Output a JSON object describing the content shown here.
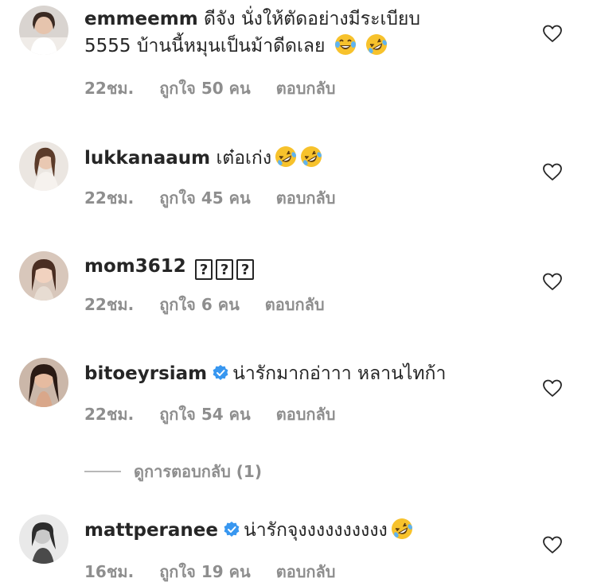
{
  "comments": [
    {
      "username": "emmeemm",
      "text_line1": "ดีจัง นั่งให้ตัดอย่างมีระเบียบ",
      "text_line2": "5555 บ้านนี้หมุนเป็นม้าดีดเลย",
      "time": "22ชม.",
      "likes": "ถูกใจ 50 คน",
      "reply": "ตอบกลับ",
      "emojis": [
        "tears-of-joy-emoji",
        "rolling-on-floor-laughing-emoji"
      ]
    },
    {
      "username": "lukkanaaum",
      "text": "เต๋อเก่ง",
      "time": "22ชม.",
      "likes": "ถูกใจ 45 คน",
      "reply": "ตอบกลับ",
      "emojis": [
        "rolling-on-floor-laughing-emoji",
        "rolling-on-floor-laughing-emoji"
      ]
    },
    {
      "username": "mom3612",
      "glyph": "?",
      "time": "22ชม.",
      "likes": "ถูกใจ 6 คน",
      "reply": "ตอบกลับ"
    },
    {
      "username": "bitoeyrsiam",
      "verified": true,
      "text": "น่ารักมากอ่าาา หลานไทก้า",
      "time": "22ชม.",
      "likes": "ถูกใจ 54 คน",
      "reply": "ตอบกลับ"
    },
    {
      "username": "mattperanee",
      "verified": true,
      "text": "น่ารักจุงงงงงงงงงง",
      "time": "16ชม.",
      "likes": "ถูกใจ 19 คน",
      "reply": "ตอบกลับ",
      "emojis": [
        "rolling-on-floor-laughing-emoji"
      ]
    }
  ],
  "view_replies": "ดูการตอบกลับ (1)",
  "icons": {
    "heart": "heart-outline-icon",
    "verified": "verified-badge-icon"
  },
  "colors": {
    "text": "#262626",
    "muted": "#8e8e8e",
    "verified": "#3897f0",
    "emoji": "#f7c22c"
  }
}
